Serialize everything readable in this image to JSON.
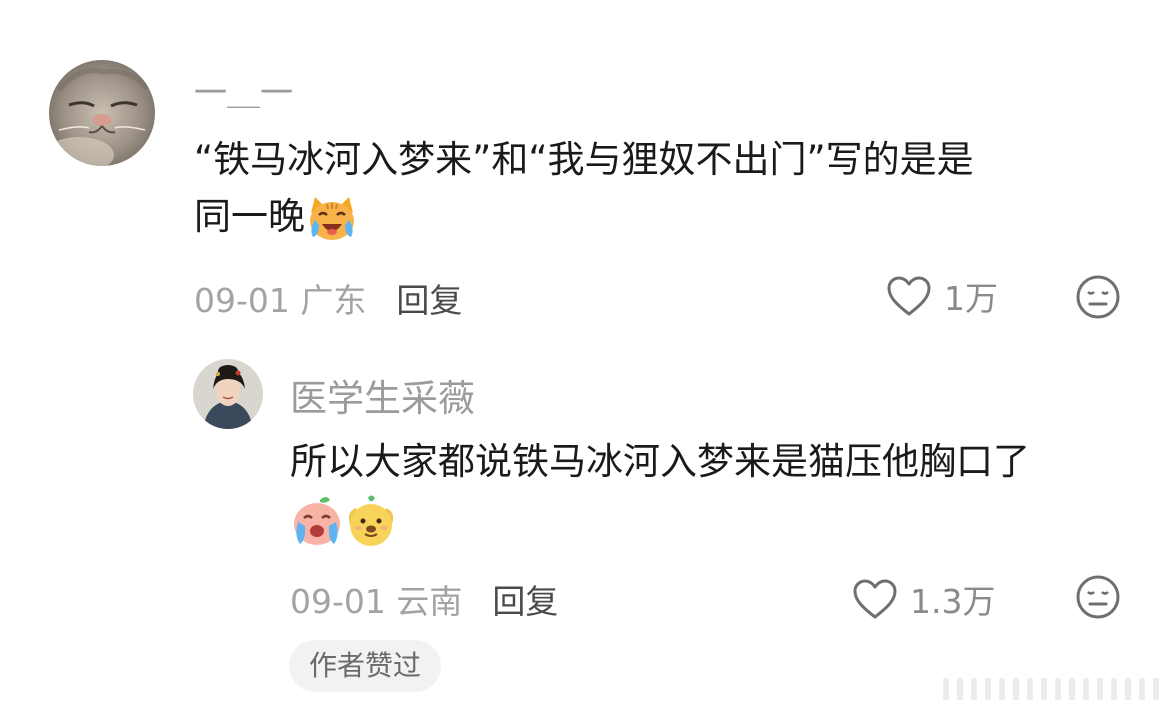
{
  "comments": [
    {
      "username": "一＿一",
      "content_line1": "“铁马冰河入梦来”和“我与狸奴不出门”写的是是",
      "content_line2": "同一晚",
      "content_emoji": "cat-laughing-crying-emoji",
      "date": "09-01 广东",
      "reply_label": "回复",
      "likes": "1万"
    },
    {
      "username": "医学生采薇",
      "content_line1": "所以大家都说铁马冰河入梦来是猫压他胸口了",
      "content_emojis": [
        "crying-emoji",
        "dog-smirk-emoji"
      ],
      "date": "09-01 云南",
      "reply_label": "回复",
      "likes": "1.3万",
      "badge": "作者赞过"
    }
  ],
  "icons": {
    "like": "heart-outline-icon",
    "dislike": "neutral-face-icon"
  },
  "colors": {
    "username": "#9b9b9b",
    "content": "#1a1a1a",
    "meta": "#a3a3a3",
    "badge_bg": "#f2f2f2"
  }
}
